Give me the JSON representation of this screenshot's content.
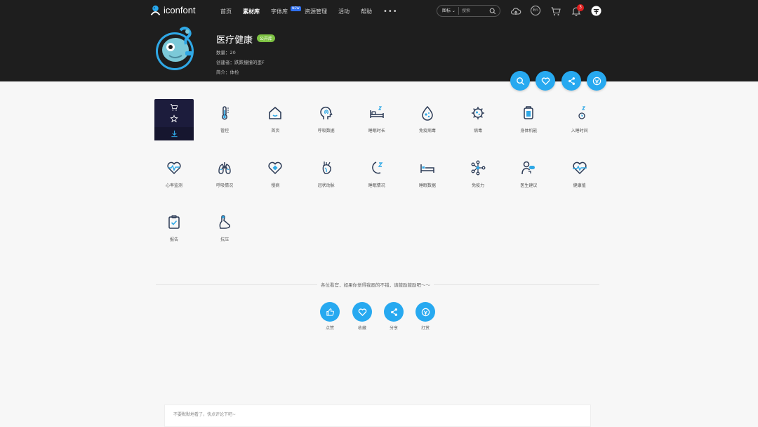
{
  "brand": {
    "name": "iconfont",
    "color": "#27a9f0"
  },
  "nav": {
    "links": [
      "首页",
      "素材库",
      "字体库",
      "资源管理",
      "活动",
      "帮助"
    ],
    "active_index": 1,
    "new_badge": "NEW",
    "more": "•••"
  },
  "search": {
    "type": "图标",
    "placeholder": "搜索"
  },
  "header_icons": [
    "cloud-upload-icon",
    "language-en-icon",
    "cart-icon",
    "bell-icon",
    "user-avatar-icon"
  ],
  "lang": "En",
  "cart_count": "3",
  "library": {
    "title": "医疗健康",
    "badge": "公开库",
    "count": "数量：20",
    "creator": "创建者：跌跌撞撞的歪F",
    "intro": "简介：体检"
  },
  "icons": [
    {
      "label": "",
      "icon": "hover-selected"
    },
    {
      "label": "管控",
      "icon": "thermometer-icon"
    },
    {
      "label": "首页",
      "icon": "home-icon"
    },
    {
      "label": "呼吸数据",
      "icon": "head-lungs-icon"
    },
    {
      "label": "睡眠时长",
      "icon": "bed-icon"
    },
    {
      "label": "免疫病毒",
      "icon": "drop-virus-icon"
    },
    {
      "label": "病毒",
      "icon": "virus-icon"
    },
    {
      "label": "身体机能",
      "icon": "body-function-icon"
    },
    {
      "label": "入睡时间",
      "icon": "moon-clock-icon"
    },
    {
      "label": "心率监测",
      "icon": "heart-pulse-icon"
    },
    {
      "label": "呼吸情况",
      "icon": "lungs-icon"
    },
    {
      "label": "慢病",
      "icon": "heart-bandage-icon"
    },
    {
      "label": "冠状动脉",
      "icon": "heart-artery-icon"
    },
    {
      "label": "睡眠情况",
      "icon": "moon-z-icon"
    },
    {
      "label": "睡眠数据",
      "icon": "hospital-bed-icon"
    },
    {
      "label": "免疫力",
      "icon": "molecule-icon"
    },
    {
      "label": "医生建议",
      "icon": "doctor-icon"
    },
    {
      "label": "健康值",
      "icon": "heart-wave-icon"
    },
    {
      "label": "报告",
      "icon": "clipboard-check-icon"
    },
    {
      "label": "抗压",
      "icon": "muscle-arm-icon"
    }
  ],
  "encourage_text": "各位看官，如果你觉得我画的不错，请鼓励鼓励吧～～",
  "social": [
    {
      "label": "点赞",
      "icon": "thumbs-up-icon"
    },
    {
      "label": "收藏",
      "icon": "heart-icon"
    },
    {
      "label": "分享",
      "icon": "share-icon"
    },
    {
      "label": "打赏",
      "icon": "reward-icon"
    }
  ],
  "comment_placeholder": "不要默默地看了，快点评论下吧~"
}
